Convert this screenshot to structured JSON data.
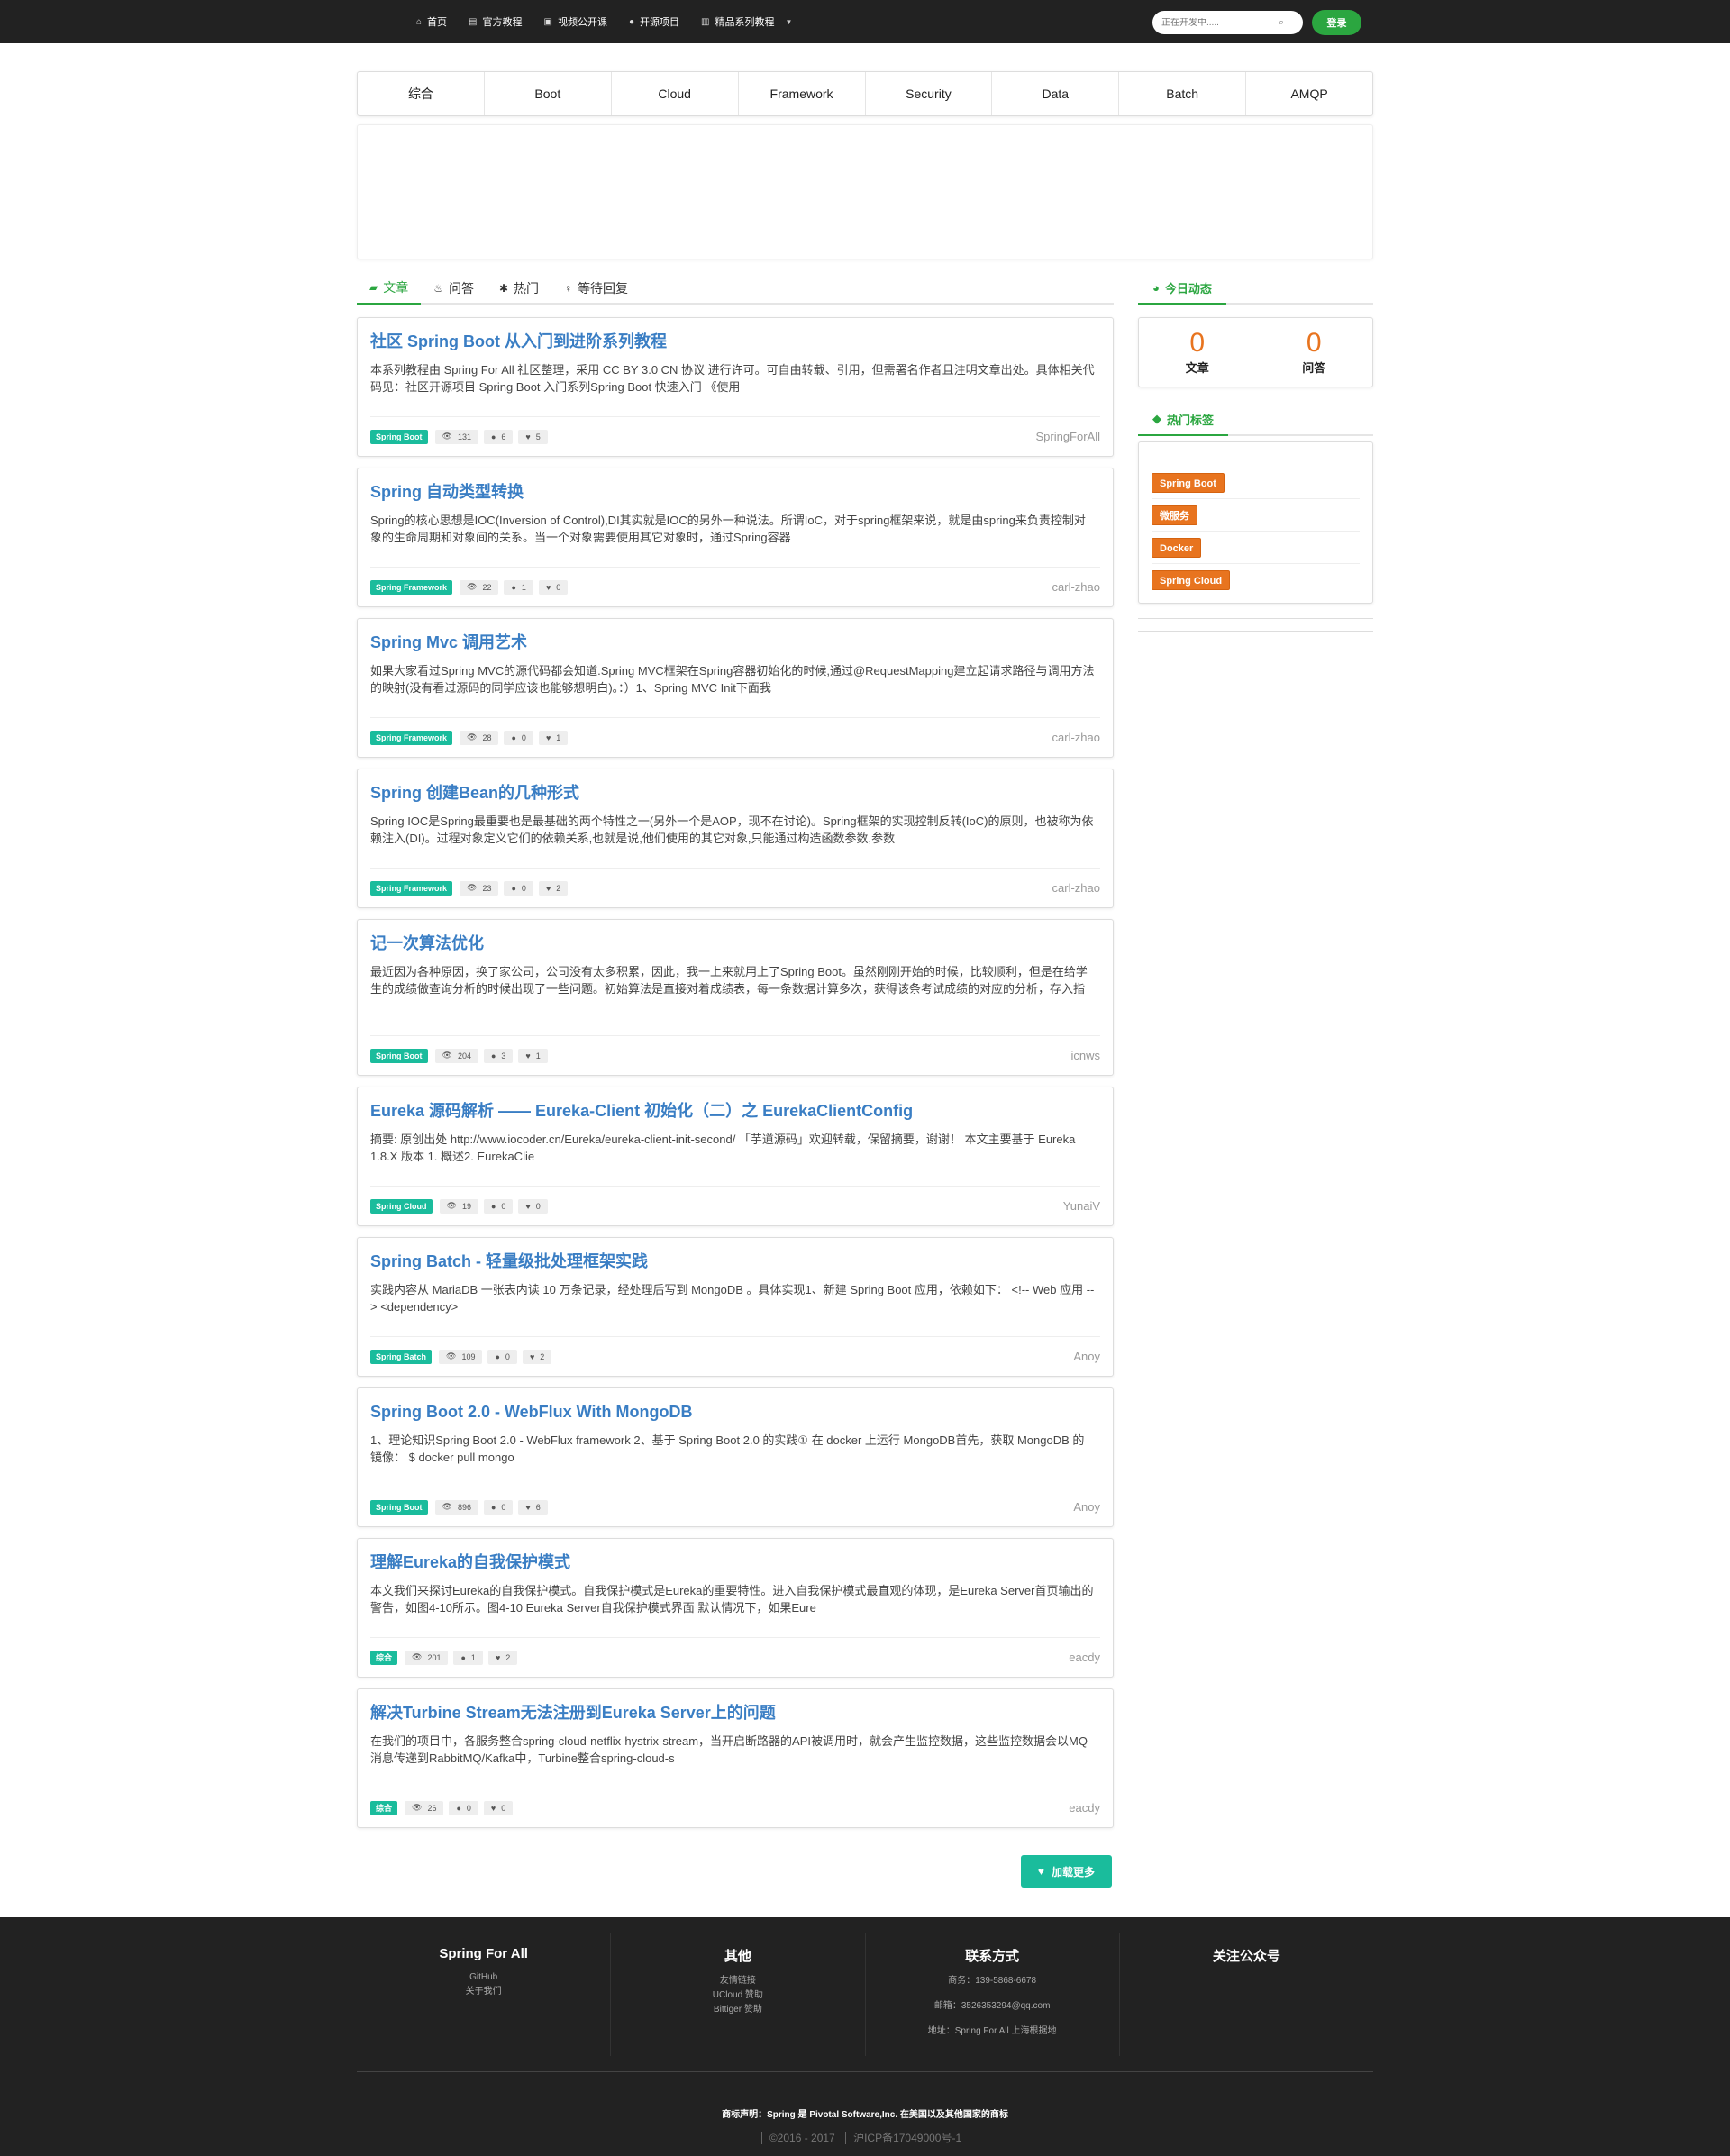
{
  "nav": {
    "links": [
      {
        "icon": "home-icon",
        "glyph": "⌂",
        "label": "首页"
      },
      {
        "icon": "document-icon",
        "glyph": "▤",
        "label": "官方教程"
      },
      {
        "icon": "video-icon",
        "glyph": "▣",
        "label": "视频公开课"
      },
      {
        "icon": "github-icon",
        "glyph": "●",
        "label": "开源项目"
      },
      {
        "icon": "book-icon",
        "glyph": "▥",
        "label": "精品系列教程"
      }
    ],
    "search_placeholder": "正在开发中.....",
    "login_label": "登录"
  },
  "categories": [
    "综合",
    "Boot",
    "Cloud",
    "Framework",
    "Security",
    "Data",
    "Batch",
    "AMQP"
  ],
  "content_tabs": [
    {
      "icon": "book-icon",
      "glyph": "▰",
      "label": "文章"
    },
    {
      "icon": "flask-icon",
      "glyph": "♨",
      "label": "问答"
    },
    {
      "icon": "gear-icon",
      "glyph": "✱",
      "label": "热门"
    },
    {
      "icon": "lightbulb-icon",
      "glyph": "♀",
      "label": "等待回复"
    }
  ],
  "articles": [
    {
      "title": "社区 Spring Boot 从入门到进阶系列教程",
      "summary": "本系列教程由 Spring For All 社区整理，采用 CC BY 3.0 CN 协议 进行许可。可自由转载、引用，但需署名作者且注明文章出处。具体相关代码见：社区开源项目 Spring Boot 入门系列Spring Boot 快速入门 《使用",
      "tag": "Spring Boot",
      "views": "131",
      "comments": "6",
      "likes": "5",
      "author": "SpringForAll",
      "lines": 2
    },
    {
      "title": "Spring 自动类型转换",
      "summary": "Spring的核心思想是IOC(Inversion of Control),DI其实就是IOC的另外一种说法。所谓IoC，对于spring框架来说，就是由spring来负责控制对象的生命周期和对象间的关系。当一个对象需要使用其它对象时，通过Spring容器",
      "tag": "Spring Framework",
      "views": "22",
      "comments": "1",
      "likes": "0",
      "author": "carl-zhao",
      "lines": 2
    },
    {
      "title": "Spring Mvc 调用艺术",
      "summary": "如果大家看过Spring MVC的源代码都会知道.Spring MVC框架在Spring容器初始化的时候,通过@RequestMapping建立起请求路径与调用方法的映射(没有看过源码的同学应该也能够想明白)。：）1、Spring MVC Init下面我",
      "tag": "Spring Framework",
      "views": "28",
      "comments": "0",
      "likes": "1",
      "author": "carl-zhao",
      "lines": 2
    },
    {
      "title": "Spring 创建Bean的几种形式",
      "summary": "Spring IOC是Spring最重要也是最基础的两个特性之一(另外一个是AOP，现不在讨论)。Spring框架的实现控制反转(IoC)的原则，也被称为依赖注入(DI)。过程对象定义它们的依赖关系,也就是说,他们使用的其它对象,只能通过构造函数参数,参数",
      "tag": "Spring Framework",
      "views": "23",
      "comments": "0",
      "likes": "2",
      "author": "carl-zhao",
      "lines": 2
    },
    {
      "title": "记一次算法优化",
      "summary": "最近因为各种原因，换了家公司，公司没有太多积累，因此，我一上来就用上了Spring Boot。虽然刚刚开始的时候，比较顺利，但是在给学生的成绩做查询分析的时候出现了一些问题。初始算法是直接对着成绩表，每一条数据计算多次，获得该条考试成绩的对应的分析，存入指",
      "tag": "Spring Boot",
      "views": "204",
      "comments": "3",
      "likes": "1",
      "author": "icnws",
      "lines": 3
    },
    {
      "title": "Eureka 源码解析 —— Eureka-Client 初始化（二）之 EurekaClientConfig",
      "summary": "摘要: 原创出处 http://www.iocoder.cn/Eureka/eureka-client-init-second/ 「芋道源码」欢迎转载，保留摘要，谢谢！ 本文主要基于 Eureka 1.8.X 版本 1. 概述2. EurekaClie",
      "tag": "Spring Cloud",
      "views": "19",
      "comments": "0",
      "likes": "0",
      "author": "YunaiV",
      "lines": 2
    },
    {
      "title": "Spring Batch - 轻量级批处理框架实践",
      "summary": "实践内容从 MariaDB 一张表内读 10 万条记录，经处理后写到 MongoDB 。具体实现1、新建 Spring Boot 应用，依赖如下： <!-- Web 应用 --> <dependency>",
      "tag": "Spring Batch",
      "views": "109",
      "comments": "0",
      "likes": "2",
      "author": "Anoy",
      "lines": 2
    },
    {
      "title": "Spring Boot 2.0 - WebFlux With MongoDB",
      "summary": "1、理论知识Spring Boot 2.0 - WebFlux framework 2、基于 Spring Boot 2.0 的实践① 在 docker 上运行 MongoDB首先，获取 MongoDB 的镜像： $ docker pull mongo",
      "tag": "Spring Boot",
      "views": "896",
      "comments": "0",
      "likes": "6",
      "author": "Anoy",
      "lines": 2
    },
    {
      "title": "理解Eureka的自我保护模式",
      "summary": "本文我们来探讨Eureka的自我保护模式。自我保护模式是Eureka的重要特性。进入自我保护模式最直观的体现，是Eureka Server首页输出的警告，如图4-10所示。图4-10 Eureka Server自我保护模式界面 默认情况下，如果Eure",
      "tag": "综合",
      "views": "201",
      "comments": "1",
      "likes": "2",
      "author": "eacdy",
      "lines": 2
    },
    {
      "title": "解决Turbine Stream无法注册到Eureka Server上的问题",
      "summary": "在我们的项目中，各服务整合spring-cloud-netflix-hystrix-stream，当开启断路器的API被调用时，就会产生监控数据，这些监控数据会以MQ消息传递到RabbitMQ/Kafka中，Turbine整合spring-cloud-s",
      "tag": "综合",
      "views": "26",
      "comments": "0",
      "likes": "0",
      "author": "eacdy",
      "lines": 2
    }
  ],
  "load_more_label": "加载更多",
  "sidebar": {
    "today_title": "今日动态",
    "stats": [
      {
        "value": "0",
        "label": "文章"
      },
      {
        "value": "0",
        "label": "问答"
      }
    ],
    "hot_tags_title": "热门标签",
    "hot_tags": [
      "Spring Boot",
      "微服务",
      "Docker",
      "Spring Cloud"
    ]
  },
  "footer": {
    "columns": [
      {
        "title": "Spring For All",
        "links": [
          "GitHub",
          "关于我们"
        ]
      },
      {
        "title": "其他",
        "links": [
          "友情链接",
          "UCloud 赞助",
          "Bittiger 赞助"
        ]
      },
      {
        "title": "联系方式",
        "contacts": [
          "商务：139-5868-6678",
          "邮箱：3526353294@qq.com",
          "地址：Spring For All 上海根据地"
        ]
      },
      {
        "title": "关注公众号",
        "links": []
      }
    ],
    "notice": "商标声明：Spring 是 Pivotal Software,Inc. 在美国以及其他国家的商标",
    "copyright": "©2016 - 2017",
    "icp": "沪ICP备17049000号-1"
  },
  "colors": {
    "accent_green": "#2ba640",
    "title_blue": "#3a7ec4",
    "tag_teal": "#1abc9c",
    "hot_tag_orange": "#e8741f",
    "dark_bg": "#222222"
  }
}
